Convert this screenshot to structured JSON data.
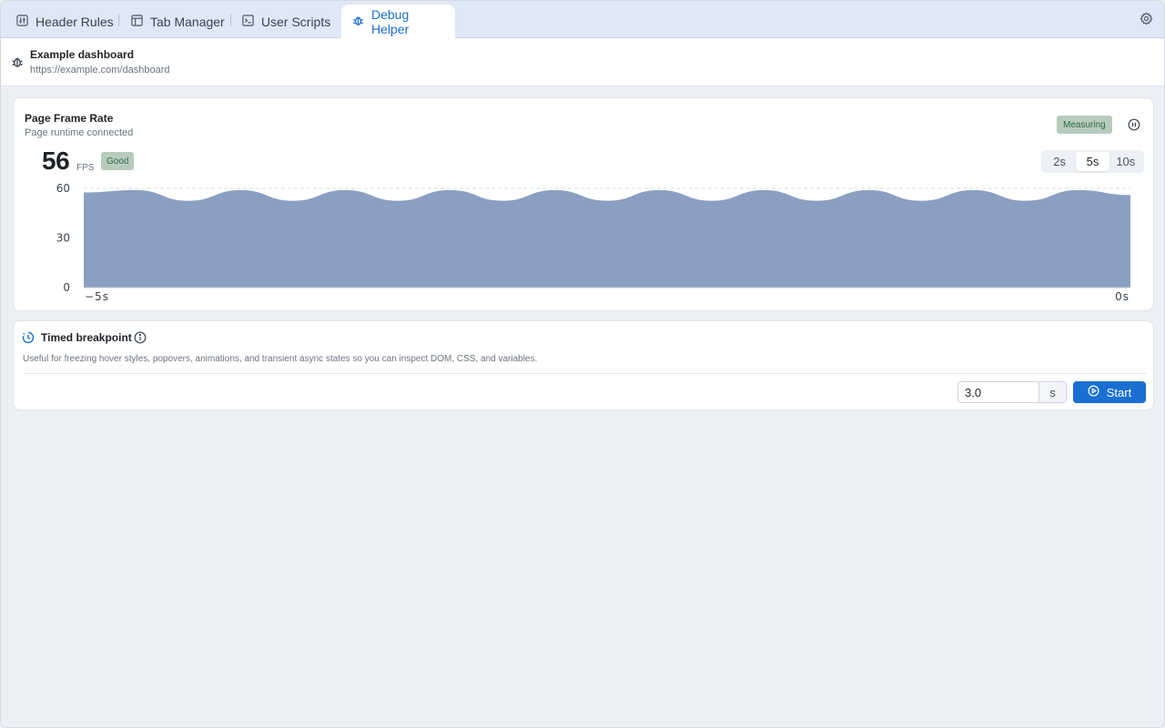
{
  "tabs": [
    {
      "label": "Header Rules",
      "icon": "sliders-icon"
    },
    {
      "label": "Tab Manager",
      "icon": "layout-icon"
    },
    {
      "label": "User Scripts",
      "icon": "terminal-icon"
    },
    {
      "label": "Debug Helper",
      "icon": "bug-icon",
      "active": true
    }
  ],
  "page": {
    "title": "Example dashboard",
    "url": "https://example.com/dashboard"
  },
  "fps_panel": {
    "title": "Page Frame Rate",
    "subtitle": "Page runtime connected",
    "status": "Measuring",
    "value": "56",
    "unit": "FPS",
    "quality": "Good",
    "ranges": [
      "2s",
      "5s",
      "10s"
    ],
    "selected_range": "5s"
  },
  "colors": {
    "accent": "#1a6fd1",
    "area_fill": "#8b9fc2",
    "good_bg": "#b7cbbd",
    "good_text": "#2e6b41"
  },
  "chart_data": {
    "type": "area",
    "ylim": [
      0,
      60
    ],
    "y_ticks": [
      "0",
      "30",
      "60"
    ],
    "x_start_label": "−5s",
    "x_end_label": "0s",
    "x_range": [
      -5,
      0
    ],
    "x": [
      -5.0,
      -4.75,
      -4.5,
      -4.25,
      -4.0,
      -3.75,
      -3.5,
      -3.25,
      -3.0,
      -2.75,
      -2.5,
      -2.25,
      -2.0,
      -1.75,
      -1.5,
      -1.25,
      -1.0,
      -0.75,
      -0.5,
      -0.25,
      0.0
    ],
    "values": [
      57.5,
      59,
      52.5,
      59,
      52.5,
      59,
      52.5,
      59,
      52.5,
      59,
      52.5,
      59,
      52.5,
      59,
      52.5,
      59,
      52.5,
      59,
      52.5,
      59,
      56
    ]
  },
  "breakpoint": {
    "title": "Timed breakpoint",
    "description": "Useful for freezing hover styles, popovers, animations, and transient async states so you can inspect DOM, CSS, and variables.",
    "delay_value": "3.0",
    "unit": "s",
    "start_label": "Start"
  }
}
